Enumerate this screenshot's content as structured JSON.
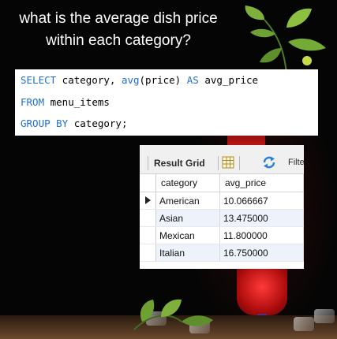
{
  "question": {
    "line1": "what is the average dish price",
    "line2": "within each category?"
  },
  "sql": {
    "line1": {
      "kw1": "SELECT",
      "t1": " category, ",
      "fn": "avg",
      "t2": "(price) ",
      "kw2": "AS",
      "t3": " avg_price"
    },
    "line2": {
      "kw": "FROM",
      "t": " menu_items"
    },
    "line3": {
      "kw": "GROUP BY",
      "t": " category;"
    }
  },
  "result_grid": {
    "label": "Result Grid",
    "filter_label": "Filte",
    "columns": [
      "category",
      "avg_price"
    ],
    "rows": [
      {
        "category": "American",
        "avg_price": "10.066667"
      },
      {
        "category": "Asian",
        "avg_price": "13.475000"
      },
      {
        "category": "Mexican",
        "avg_price": "11.800000"
      },
      {
        "category": "Italian",
        "avg_price": "16.750000"
      }
    ],
    "icons": [
      "grid-icon",
      "refresh-icon",
      "row-pointer-icon"
    ]
  },
  "colors": {
    "keyword": "#1f6fce",
    "background": "#050505",
    "alt_row": "#eef3fb"
  }
}
